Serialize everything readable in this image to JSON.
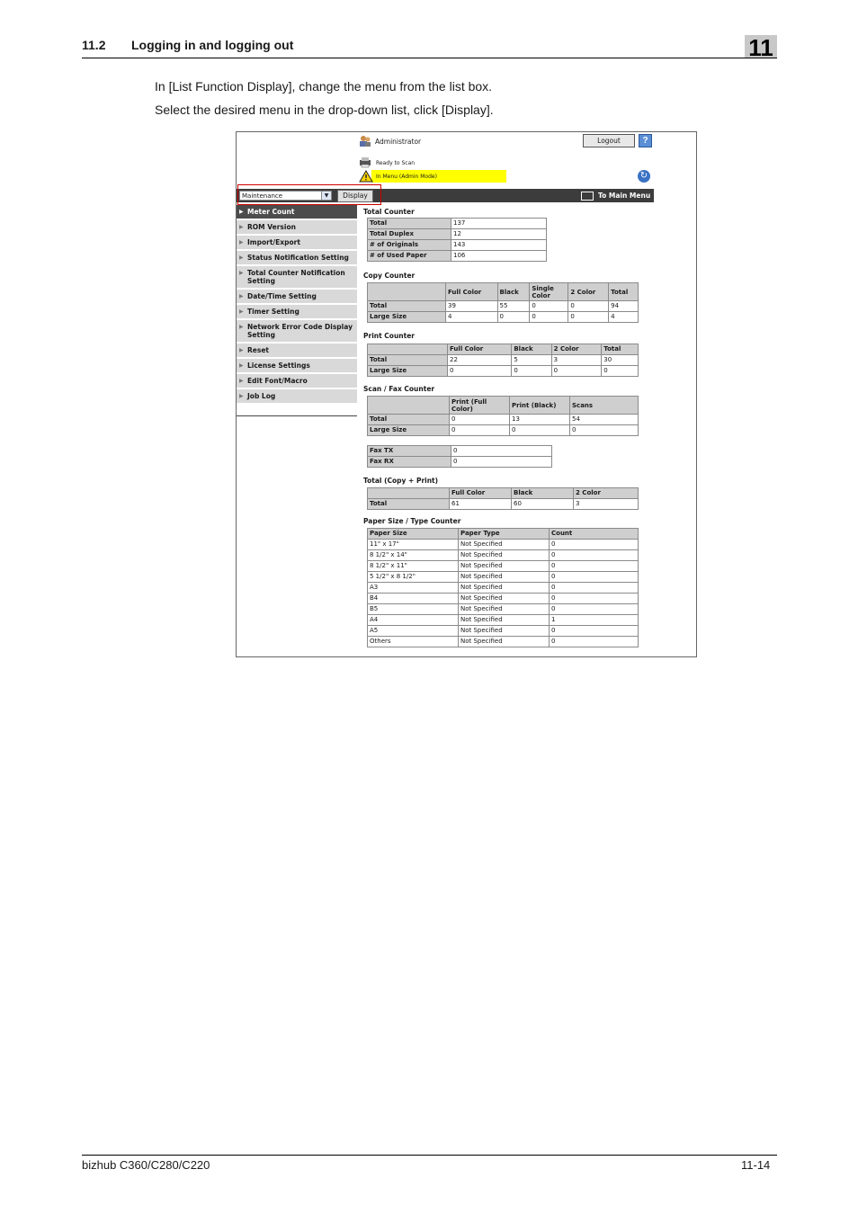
{
  "header": {
    "section": "11.2",
    "title": "Logging in and logging out",
    "chapter": "11"
  },
  "body": {
    "line1": "In [List Function Display], change the menu from the list box.",
    "line2": "Select the desired menu in the drop-down list, click [Display]."
  },
  "screen": {
    "user": "Administrator",
    "logout_label": "Logout",
    "help_icon": "?",
    "status": "Ready to Scan",
    "warning": "In Menu (Admin Mode)",
    "select_value": "Maintenance",
    "display_label": "Display",
    "main_menu_label": "To Main Menu",
    "menu": [
      "Meter Count",
      "ROM Version",
      "Import/Export",
      "Status Notification Setting",
      "Total Counter Notification Setting",
      "Date/Time Setting",
      "Timer Setting",
      "Network Error Code Display Setting",
      "Reset",
      "License Settings",
      "Edit Font/Macro",
      "Job Log"
    ],
    "total_counter": {
      "title": "Total Counter",
      "rows": [
        [
          "Total",
          "137"
        ],
        [
          "Total Duplex",
          "12"
        ],
        [
          "# of Originals",
          "143"
        ],
        [
          "# of Used Paper",
          "106"
        ]
      ]
    },
    "copy_counter": {
      "title": "Copy Counter",
      "cols": [
        "Full Color",
        "Black",
        "Single Color",
        "2 Color",
        "Total"
      ],
      "rows": [
        [
          "Total",
          "39",
          "55",
          "0",
          "0",
          "94"
        ],
        [
          "Large Size",
          "4",
          "0",
          "0",
          "0",
          "4"
        ]
      ]
    },
    "print_counter": {
      "title": "Print Counter",
      "cols": [
        "Full Color",
        "Black",
        "2 Color",
        "Total"
      ],
      "rows": [
        [
          "Total",
          "22",
          "5",
          "3",
          "30"
        ],
        [
          "Large Size",
          "0",
          "0",
          "0",
          "0"
        ]
      ]
    },
    "scan_counter": {
      "title": "Scan / Fax Counter",
      "cols": [
        "Print (Full Color)",
        "Print (Black)",
        "Scans"
      ],
      "rows": [
        [
          "Total",
          "0",
          "13",
          "54"
        ],
        [
          "Large Size",
          "0",
          "0",
          "0"
        ]
      ]
    },
    "fax": [
      [
        "Fax TX",
        "0"
      ],
      [
        "Fax RX",
        "0"
      ]
    ],
    "total_copy_print": {
      "title": "Total (Copy + Print)",
      "cols": [
        "Full Color",
        "Black",
        "2 Color"
      ],
      "rows": [
        [
          "Total",
          "61",
          "60",
          "3"
        ]
      ]
    },
    "paper_counter": {
      "title": "Paper Size / Type Counter",
      "cols": [
        "Paper Size",
        "Paper Type",
        "Count"
      ],
      "rows": [
        [
          "11\" x 17\"",
          "Not Specified",
          "0"
        ],
        [
          "8 1/2\" x 14\"",
          "Not Specified",
          "0"
        ],
        [
          "8 1/2\" x 11\"",
          "Not Specified",
          "0"
        ],
        [
          "5 1/2\" x 8 1/2\"",
          "Not Specified",
          "0"
        ],
        [
          "A3",
          "Not Specified",
          "0"
        ],
        [
          "B4",
          "Not Specified",
          "0"
        ],
        [
          "B5",
          "Not Specified",
          "0"
        ],
        [
          "A4",
          "Not Specified",
          "1"
        ],
        [
          "A5",
          "Not Specified",
          "0"
        ],
        [
          "Others",
          "Not Specified",
          "0"
        ]
      ]
    }
  },
  "footer": {
    "product": "bizhub C360/C280/C220",
    "page": "11-14"
  }
}
